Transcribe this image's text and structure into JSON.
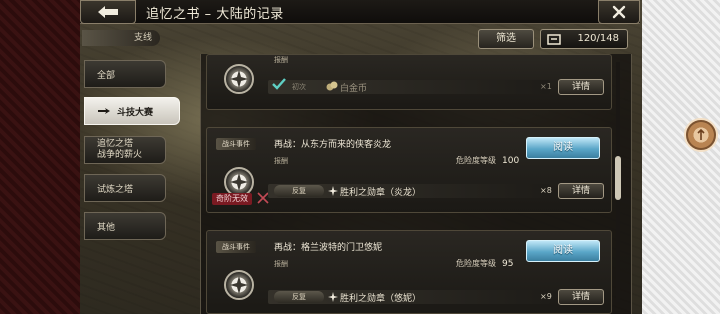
{
  "header": {
    "title": "追忆之书 – 大陆的记录"
  },
  "subbar": {
    "branch_label": "支线",
    "filter_label": "筛选",
    "count": "120/148"
  },
  "sidebar": {
    "items": [
      {
        "label": "全部"
      },
      {
        "label": "斗技大赛"
      },
      {
        "label_line1": "追忆之塔",
        "label_line2": "战争的薪火"
      },
      {
        "label": "试炼之塔"
      },
      {
        "label": "其他"
      }
    ]
  },
  "cards": [
    {
      "reward_label": "报酬",
      "repeat_label": "初次",
      "reward_name": "白金币",
      "quantity": "×1",
      "detail_label": "详情"
    },
    {
      "tag": "战斗事件",
      "title": "再战：从东方而来的侠客炎龙",
      "reward_label": "报酬",
      "danger_label": "危险度等级",
      "danger_value": "100",
      "read_label": "阅读",
      "repeat_label": "反复",
      "reward_name": "胜利之勋章（炎龙）",
      "quantity": "×8",
      "detail_label": "详情",
      "badge": "奇阶无效"
    },
    {
      "tag": "战斗事件",
      "title": "再战：格兰波特的门卫悠妮",
      "reward_label": "报酬",
      "danger_label": "危险度等级",
      "danger_value": "95",
      "read_label": "阅读",
      "repeat_label": "反复",
      "reward_name": "胜利之勋章（悠妮）",
      "quantity": "×9",
      "detail_label": "详情"
    }
  ],
  "icons": {
    "back": "arrow-left-icon",
    "close": "close-icon",
    "count": "box-icon",
    "medal": "compass-medal-icon",
    "check": "check-icon",
    "coin": "coin-icon",
    "cross": "crossed-swords-icon",
    "float": "rune-icon"
  }
}
